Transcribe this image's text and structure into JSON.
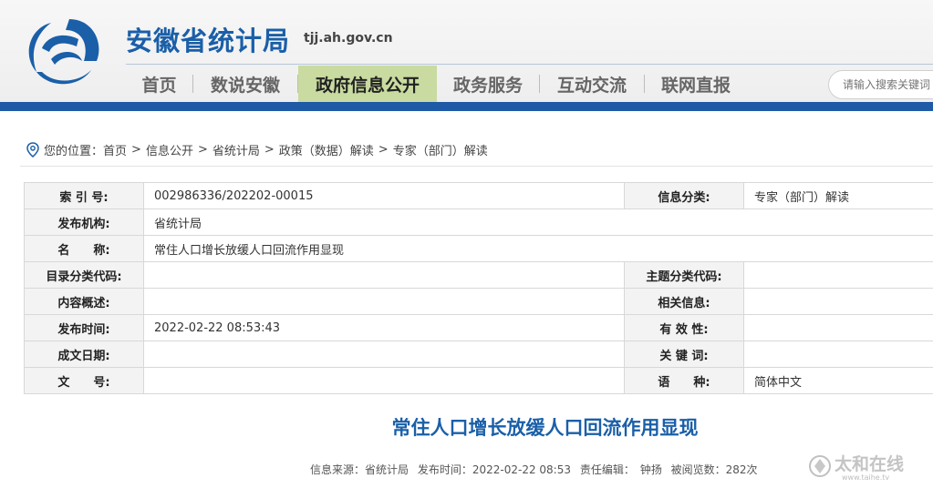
{
  "header": {
    "site_title": "安徽省统计局",
    "site_domain": "tjj.ah.gov.cn",
    "nav": [
      {
        "label": "首页",
        "active": false
      },
      {
        "label": "数说安徽",
        "active": false
      },
      {
        "label": "政府信息公开",
        "active": true
      },
      {
        "label": "政务服务",
        "active": false
      },
      {
        "label": "互动交流",
        "active": false
      },
      {
        "label": "联网直报",
        "active": false
      }
    ],
    "search_placeholder": "请输入搜索关键词"
  },
  "breadcrumb": {
    "icon": "location-pin-icon",
    "prefix": "您的位置：",
    "items": [
      "首页",
      "信息公开",
      "省统计局",
      "政策（数据）解读",
      "专家（部门）解读"
    ],
    "separator": ">"
  },
  "info": {
    "index_label": "索 引 号:",
    "index_value": "002986336/202202-00015",
    "category_label": "信息分类:",
    "category_value": "专家（部门）解读",
    "publisher_label": "发布机构:",
    "publisher_value": "省统计局",
    "name_label": "名　　称:",
    "name_value": "常住人口增长放缓人口回流作用显现",
    "catalog_label": "目录分类代码:",
    "catalog_value": "",
    "topic_label": "主题分类代码:",
    "topic_value": "",
    "summary_label": "内容概述:",
    "summary_value": "",
    "related_label": "相关信息:",
    "related_value": "",
    "pubtime_label": "发布时间:",
    "pubtime_value": "2022-02-22 08:53:43",
    "validity_label": "有 效 性:",
    "validity_value": "",
    "date_label": "成文日期:",
    "date_value": "",
    "keywords_label": "关 键 词:",
    "keywords_value": "",
    "docno_label": "文　　号:",
    "docno_value": "",
    "language_label": "语　　种:",
    "language_value": "简体中文"
  },
  "article": {
    "title": "常住人口增长放缓人口回流作用显现",
    "source": "信息来源：省统计局",
    "pubtime": "发布时间：2022-02-22 08:53",
    "editor": "责任编辑：　钟扬",
    "views": "被阅览数：282次"
  },
  "watermark": {
    "brand": "太和在线",
    "url": "www.taihe.tv"
  },
  "colors": {
    "brand_blue": "#1a5fa8",
    "bar_blue": "#1f5aa7",
    "nav_active": "#c9dba0"
  }
}
